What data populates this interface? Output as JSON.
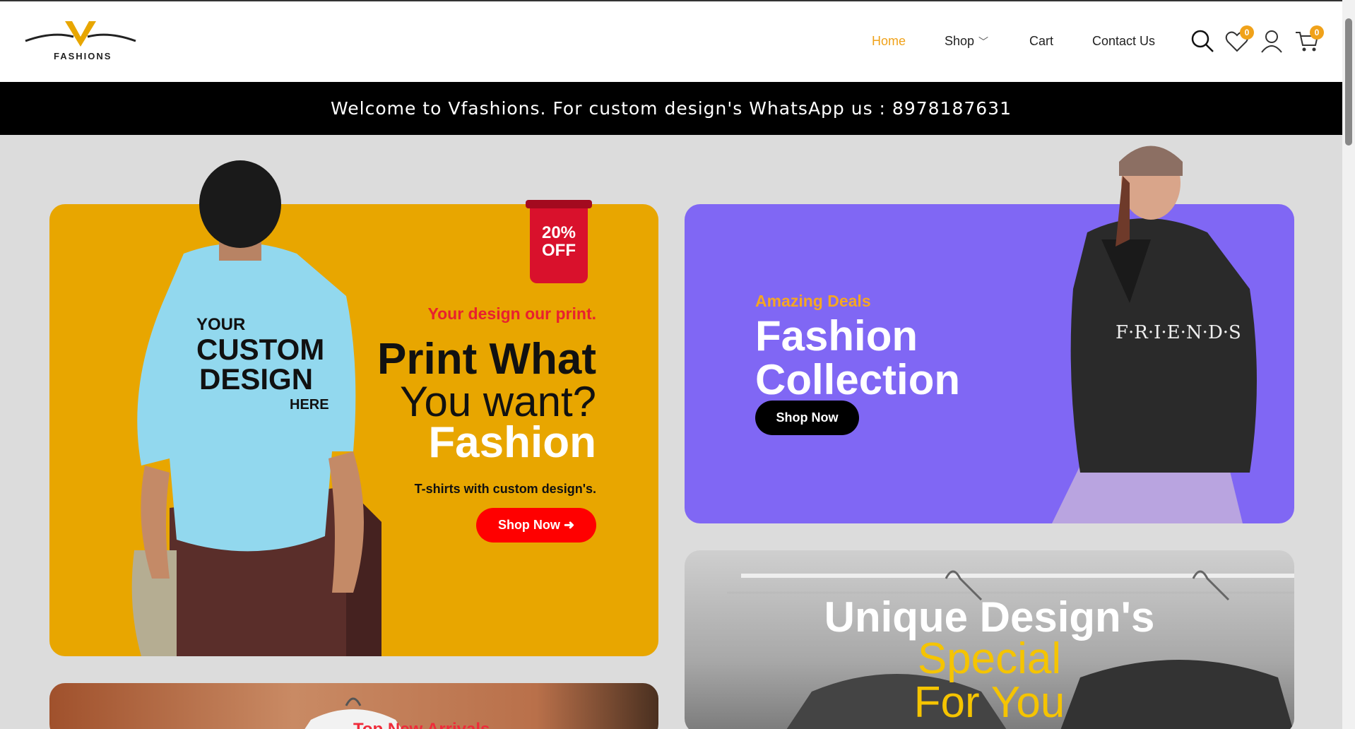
{
  "brand": {
    "logo_letter": "V",
    "logo_word": "FASHIONS"
  },
  "nav": {
    "items": [
      {
        "label": "Home",
        "active": true
      },
      {
        "label": "Shop",
        "has_dropdown": true
      },
      {
        "label": "Cart"
      },
      {
        "label": "Contact Us"
      }
    ]
  },
  "header_icons": {
    "search": "search-icon",
    "wishlist": {
      "icon": "heart-icon",
      "count": "0"
    },
    "account": "user-icon",
    "cart": {
      "icon": "cart-icon",
      "count": "0"
    }
  },
  "announcement": "Welcome to Vfashions. For custom design's WhatsApp us : 8978187631",
  "banner_custom": {
    "ribbon_line1": "20%",
    "ribbon_line2": "OFF",
    "subtitle": "Your design our print.",
    "heading_line1": "Print What",
    "heading_line2": "You want?",
    "heading_line3": "Fashion",
    "description": "T-shirts with custom design's.",
    "button": "Shop Now",
    "shirt_print": [
      "YOUR",
      "CUSTOM",
      "DESIGN",
      "HERE"
    ]
  },
  "banner_collection": {
    "subtitle": "Amazing Deals",
    "heading_line1": "Fashion",
    "heading_line2": "Collection",
    "button": "Shop Now",
    "hoodie_print": "F·R·I·E·N·D·S"
  },
  "banner_unique": {
    "heading_line1": "Unique Design's",
    "heading_line2": "Special",
    "heading_line3": "For You"
  },
  "banner_arrivals": {
    "title": "Top New Arrivals"
  },
  "colors": {
    "accent": "#f0a21a",
    "announcement_bg": "#000000",
    "banner_custom_bg": "#e8a600",
    "banner_collection_bg": "#8067f4",
    "cta_red": "#ff0000"
  }
}
